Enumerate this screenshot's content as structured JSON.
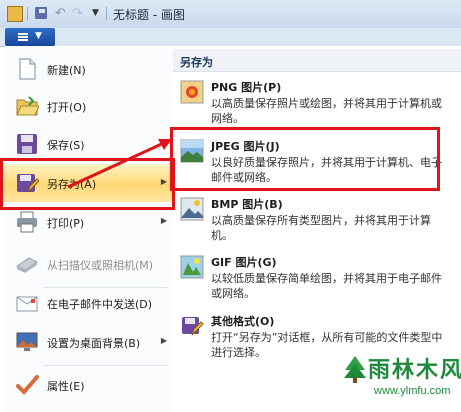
{
  "window": {
    "title": "无标题 - 画图"
  },
  "file_menu": {
    "items": [
      {
        "label": "新建(N)",
        "icon": "new-document-icon"
      },
      {
        "label": "打开(O)",
        "icon": "open-folder-icon"
      },
      {
        "label": "保存(S)",
        "icon": "save-disk-icon"
      },
      {
        "label": "另存为(A)",
        "icon": "save-as-icon"
      },
      {
        "label": "打印(P)",
        "icon": "printer-icon"
      },
      {
        "label": "从扫描仪或照相机(M)",
        "icon": "scanner-icon"
      },
      {
        "label": "在电子邮件中发送(D)",
        "icon": "email-icon"
      },
      {
        "label": "设置为桌面背景(B)",
        "icon": "desktop-background-icon"
      },
      {
        "label": "属性(E)",
        "icon": "properties-checkmark-icon"
      }
    ]
  },
  "save_as_panel": {
    "header": "另存为",
    "formats": [
      {
        "title": "PNG 图片(P)",
        "desc": "以高质量保存照片或绘图，并将其用于计算机或网络。",
        "icon": "png-image-icon"
      },
      {
        "title": "JPEG 图片(J)",
        "desc": "以良好质量保存照片，并将其用于计算机、电子邮件或网络。",
        "icon": "jpeg-image-icon"
      },
      {
        "title": "BMP 图片(B)",
        "desc": "以高质量保存所有类型图片，并将其用于计算机。",
        "icon": "bmp-image-icon"
      },
      {
        "title": "GIF 图片(G)",
        "desc": "以较低质量保存简单绘图，并将其用于电子邮件或网络。",
        "icon": "gif-image-icon"
      },
      {
        "title": "其他格式(O)",
        "desc": "打开“另存为”对话框，从所有可能的文件类型中进行选择。",
        "icon": "other-formats-icon"
      }
    ]
  },
  "watermark": {
    "text": "雨林木风",
    "sub": "www.ylmfu.com"
  },
  "colors": {
    "highlight": "#ffd875",
    "annotation": "#e0141b",
    "app_button": "#1f56ab"
  }
}
